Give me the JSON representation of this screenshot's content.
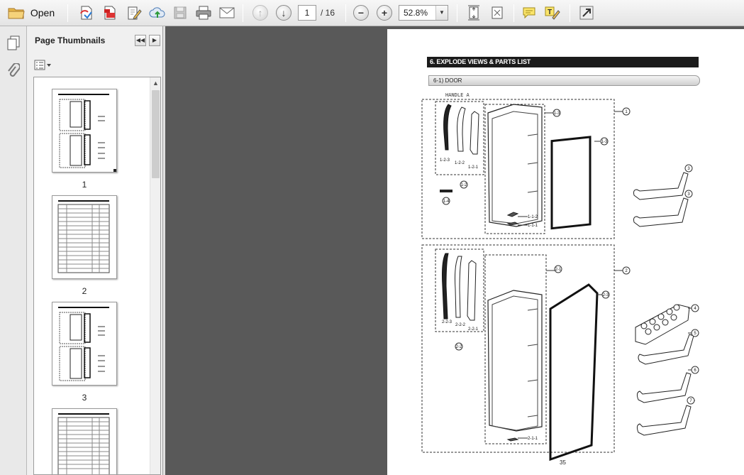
{
  "toolbar": {
    "open_label": "Open",
    "current_page": "1",
    "total_pages": "/ 16",
    "zoom": "52.8%"
  },
  "panel": {
    "title": "Page Thumbnails",
    "thumbnails": [
      {
        "label": "1"
      },
      {
        "label": "2"
      },
      {
        "label": "3"
      }
    ]
  },
  "document": {
    "section_title": "6. EXPLODE VIEWS & PARTS LIST",
    "subsection": "6-1) DOOR",
    "handle_label": "HANDLE A",
    "page_number": "35",
    "callouts_top": [
      "1",
      "1-3",
      "1-3",
      "3",
      "3",
      "1-2",
      "1-4",
      "1-2-3",
      "1-2-2",
      "1-2-1",
      "1-1-2",
      "1-1-1"
    ],
    "callouts_bottom": [
      "2",
      "2-1",
      "2-3",
      "4",
      "5",
      "6",
      "7",
      "2-2",
      "2-2-3",
      "2-2-2",
      "2-2-1",
      "2-1-1"
    ]
  },
  "icons": {
    "accent": "#3a78c3",
    "dark": "#1b1b1b",
    "viewport_bg": "#595959"
  }
}
